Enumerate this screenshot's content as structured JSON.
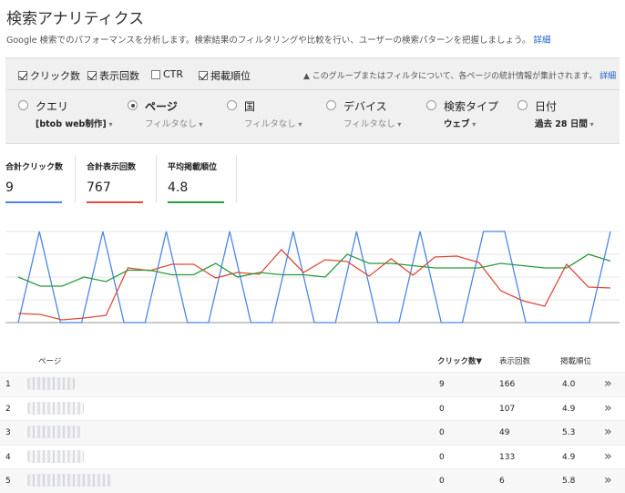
{
  "header": {
    "title": "検索アナリティクス",
    "description": "Google 検索でのパフォーマンスを分析します。検索結果のフィルタリングや比較を行い、ユーザーの検索パターンを把握しましょう。",
    "description_link": "詳細"
  },
  "metric_toggles": [
    {
      "label": "クリック数",
      "checked": true
    },
    {
      "label": "表示回数",
      "checked": true
    },
    {
      "label": "CTR",
      "checked": false
    },
    {
      "label": "掲載順位",
      "checked": true
    }
  ],
  "notice": {
    "icon": "warning-icon",
    "text": "このグループまたはフィルタについて、各ページの統計情報が集計されます。",
    "link": "詳細"
  },
  "dimensions": [
    {
      "label": "クエリ",
      "filter": "[btob web制作]",
      "selected": false
    },
    {
      "label": "ページ",
      "filter": "フィルタなし",
      "selected": true
    },
    {
      "label": "国",
      "filter": "フィルタなし",
      "selected": false
    },
    {
      "label": "デバイス",
      "filter": "フィルタなし",
      "selected": false
    },
    {
      "label": "検索タイプ",
      "filter": "ウェブ",
      "selected": false
    },
    {
      "label": "日付",
      "filter": "過去 28 日間",
      "selected": false
    }
  ],
  "totals": [
    {
      "label": "合計クリック数",
      "value": "9",
      "color": "#4a86e8"
    },
    {
      "label": "合計表示回数",
      "value": "767",
      "color": "#dd4b39"
    },
    {
      "label": "平均掲載順位",
      "value": "4.8",
      "color": "#2a9a3a"
    }
  ],
  "chart_data": {
    "type": "line",
    "grid": true,
    "legend": "none",
    "series": [
      {
        "color": "#4a86e8",
        "values": [
          0,
          1,
          0,
          0,
          1,
          0,
          0,
          1,
          0,
          0,
          1,
          0,
          0,
          1,
          0,
          0,
          1,
          0,
          0,
          1,
          0,
          0,
          1,
          1,
          0,
          0,
          0,
          0,
          1
        ]
      },
      {
        "color": "#dd4b39",
        "values": [
          10,
          9,
          3,
          5,
          8,
          60,
          57,
          64,
          64,
          49,
          55,
          53,
          80,
          55,
          69,
          67,
          51,
          70,
          52,
          72,
          73,
          66,
          35,
          24,
          18,
          64,
          39,
          38
        ]
      },
      {
        "color": "#2a9a3a",
        "values": [
          5.0,
          4.6,
          4.6,
          5.0,
          4.8,
          5.3,
          5.3,
          5.1,
          5.1,
          5.6,
          5.0,
          5.2,
          5.1,
          5.1,
          5.0,
          6.0,
          5.6,
          5.6,
          5.5,
          5.4,
          5.4,
          5.4,
          5.6,
          5.5,
          5.4,
          5.4,
          6.0,
          5.7
        ]
      }
    ]
  },
  "table": {
    "headers": {
      "page": "ページ",
      "clicks": "クリック数",
      "sort_icon": "▼",
      "impressions": "表示回数",
      "position": "掲載順位"
    },
    "rows": [
      {
        "rank": "1",
        "clicks": "9",
        "impressions": "166",
        "position": "4.0"
      },
      {
        "rank": "2",
        "clicks": "0",
        "impressions": "107",
        "position": "4.9"
      },
      {
        "rank": "3",
        "clicks": "0",
        "impressions": "49",
        "position": "5.3"
      },
      {
        "rank": "4",
        "clicks": "0",
        "impressions": "133",
        "position": "4.9"
      },
      {
        "rank": "5",
        "clicks": "0",
        "impressions": "6",
        "position": "5.8"
      }
    ],
    "row_action_icon": "»"
  }
}
